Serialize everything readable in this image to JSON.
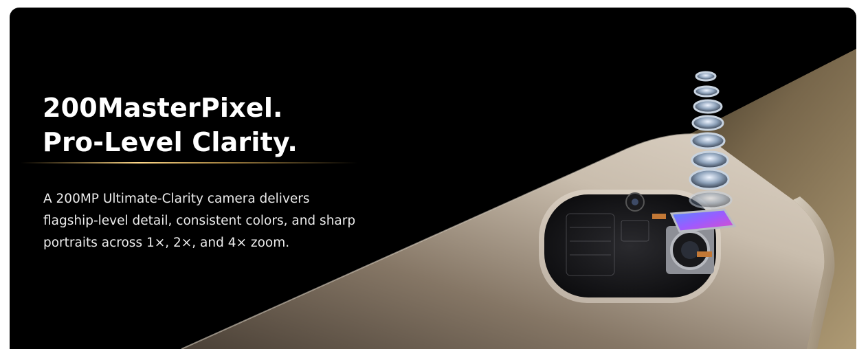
{
  "banner": {
    "headline": {
      "line1": "200MasterPixel.",
      "line2": "Pro-Level Clarity."
    },
    "description": {
      "line1": "A 200MP Ultimate-Clarity camera delivers",
      "line2": "flagship-level detail, consistent colors, and sharp",
      "line3": "portraits across 1×, 2×, and 4× zoom."
    },
    "colors": {
      "background": "#000000",
      "accent_glow": "#e8b85c",
      "phone_body": "#b9ab98",
      "headline_text": "#ffffff"
    },
    "image": {
      "subject": "phone-camera-lens-stack",
      "sensor_color": "#8a5bff"
    }
  }
}
